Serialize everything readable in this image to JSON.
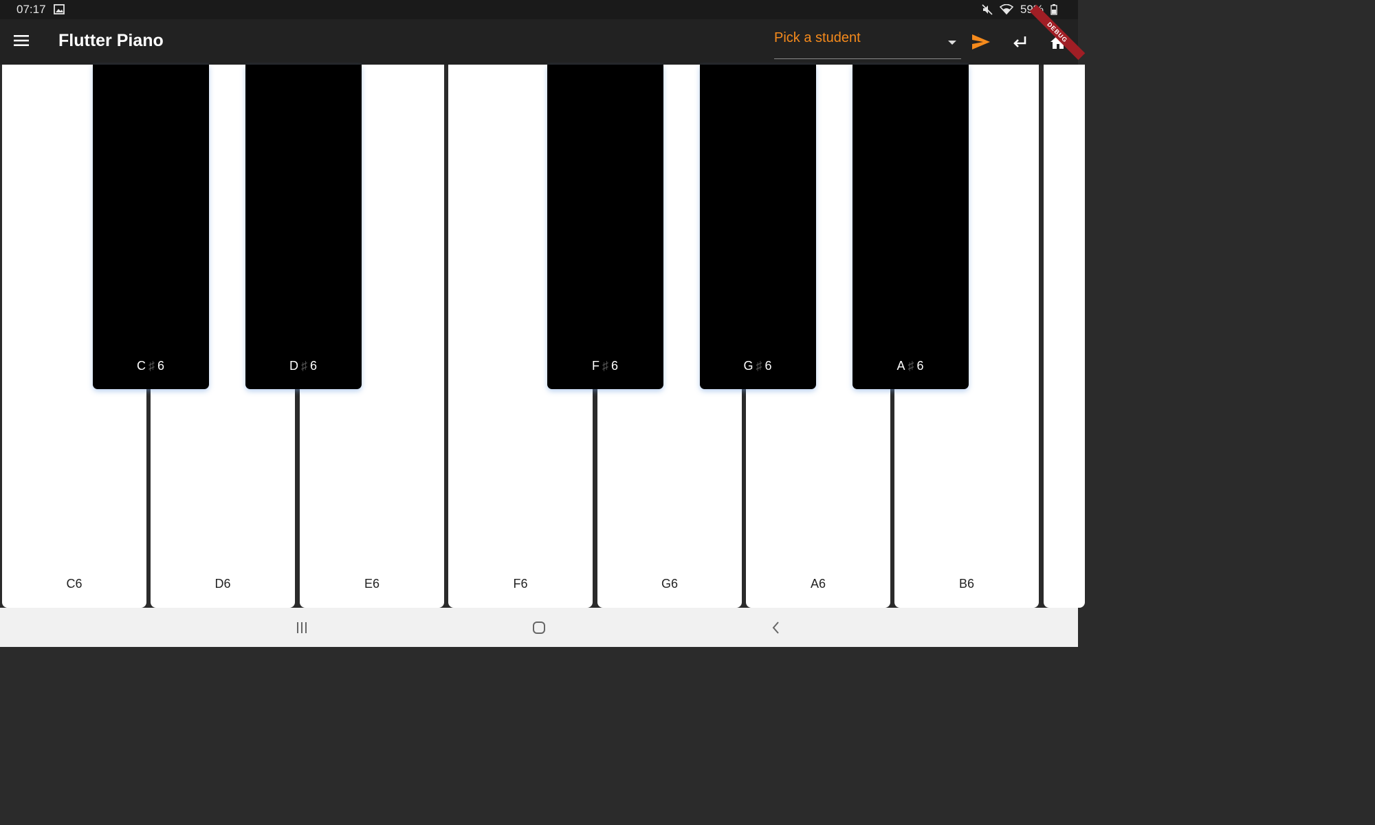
{
  "status_bar": {
    "time": "07:17",
    "battery": "59%",
    "icons": [
      "gallery-icon",
      "mute-icon",
      "wifi-icon",
      "battery-icon"
    ]
  },
  "app_bar": {
    "title": "Flutter Piano",
    "student_dropdown": {
      "placeholder": "Pick a student"
    },
    "debug_banner": "DEBUG",
    "icons": [
      "menu-icon",
      "send-icon",
      "enter-icon",
      "home-icon"
    ],
    "accent_color": "#f58a1c"
  },
  "keyboard": {
    "white_keys": [
      "C6",
      "D6",
      "E6",
      "F6",
      "G6",
      "A6",
      "B6"
    ],
    "black_keys": [
      {
        "letter": "C",
        "octave": "6"
      },
      {
        "letter": "D",
        "octave": "6"
      },
      {
        "letter": "F",
        "octave": "6"
      },
      {
        "letter": "G",
        "octave": "6"
      },
      {
        "letter": "A",
        "octave": "6"
      }
    ],
    "sharp_symbol": "♯"
  },
  "nav_bar": {
    "icons": [
      "recents-icon",
      "home-circle-icon",
      "back-icon"
    ]
  }
}
